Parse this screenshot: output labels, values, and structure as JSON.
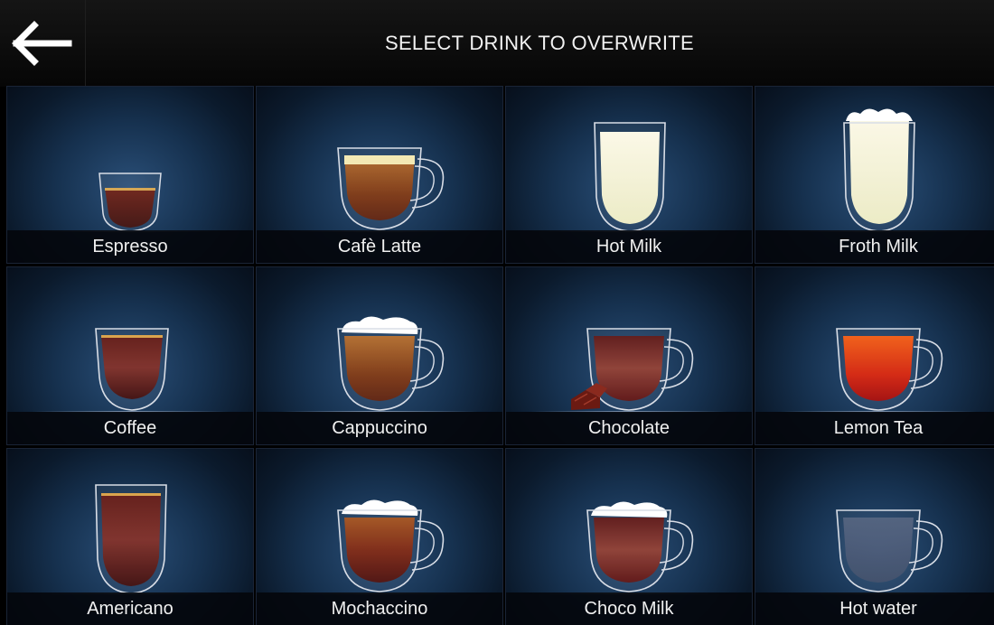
{
  "header": {
    "title": "SELECT DRINK TO OVERWRITE",
    "back_icon": "arrow-left-icon"
  },
  "drinks": [
    {
      "label": "Espresso",
      "icon": "espresso-cup-icon"
    },
    {
      "label": "Cafè Latte",
      "icon": "cafe-latte-cup-icon"
    },
    {
      "label": "Hot Milk",
      "icon": "hot-milk-glass-icon"
    },
    {
      "label": "Froth Milk",
      "icon": "froth-milk-glass-icon"
    },
    {
      "label": "Coffee",
      "icon": "coffee-cup-icon"
    },
    {
      "label": "Cappuccino",
      "icon": "cappuccino-cup-icon"
    },
    {
      "label": "Chocolate",
      "icon": "chocolate-cup-icon"
    },
    {
      "label": "Lemon Tea",
      "icon": "lemon-tea-cup-icon"
    },
    {
      "label": "Americano",
      "icon": "americano-glass-icon"
    },
    {
      "label": "Mochaccino",
      "icon": "mochaccino-cup-icon"
    },
    {
      "label": "Choco Milk",
      "icon": "choco-milk-cup-icon"
    },
    {
      "label": "Hot water",
      "icon": "hot-water-cup-icon"
    }
  ],
  "colors": {
    "coffee": "#5a1410",
    "crema": "#d4a24a",
    "latte": "#8b4513",
    "milk": "#f3f0d6",
    "tea": "#e0400a",
    "water": "#4a5a78"
  }
}
